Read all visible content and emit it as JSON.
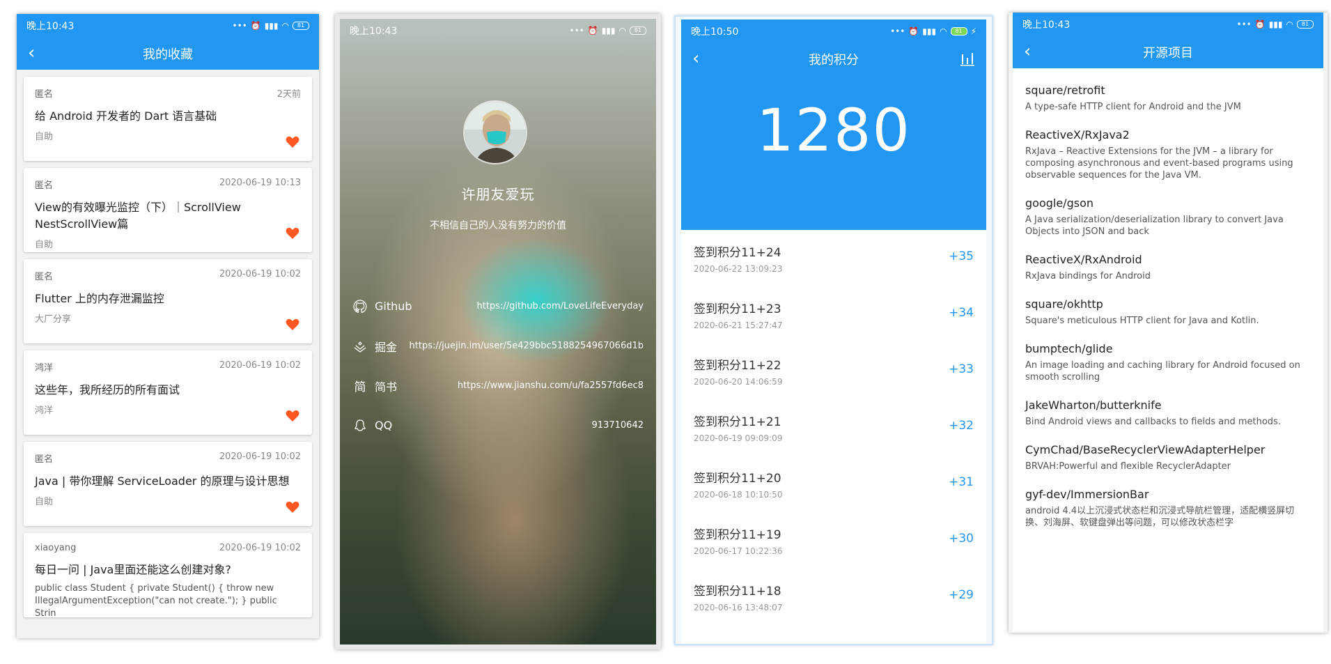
{
  "status": {
    "time1": "晚上10:43",
    "time2": "晚上10:43",
    "time3": "晚上10:50",
    "time4": "晚上10:43",
    "battery": "81"
  },
  "favorites": {
    "title": "我的收藏",
    "items": [
      {
        "author": "匿名",
        "date": "2天前",
        "title": "给 Android 开发者的 Dart 语言基础",
        "category": "自助"
      },
      {
        "author": "匿名",
        "date": "2020-06-19 10:13",
        "title": "View的有效曝光监控（下）｜ScrollView NestScrollView篇",
        "category": "自助"
      },
      {
        "author": "匿名",
        "date": "2020-06-19 10:02",
        "title": "Flutter 上的内存泄漏监控",
        "category": "大厂分享"
      },
      {
        "author": "鸿洋",
        "date": "2020-06-19 10:02",
        "title": "这些年，我所经历的所有面试",
        "category": "鸿洋"
      },
      {
        "author": "匿名",
        "date": "2020-06-19 10:02",
        "title": "Java | 带你理解 ServiceLoader 的原理与设计思想",
        "category": "自助"
      },
      {
        "author": "xiaoyang",
        "date": "2020-06-19 10:02",
        "title": "每日一问 | Java里面还能这么创建对象?",
        "excerpt": "public class Student { private Student() { throw new IllegalArgumentException(\"can not create.\"); } public Strin"
      }
    ]
  },
  "about": {
    "name": "许朋友爱玩",
    "motto": "不相信自己的人没有努力的价值",
    "links": [
      {
        "icon": "github-icon",
        "name": "Github",
        "value": "https://github.com/LoveLifeEveryday"
      },
      {
        "icon": "juejin-icon",
        "name": "掘金",
        "value": "https://juejin.im/user/5e429bbc5188254967066d1b"
      },
      {
        "icon": "jianshu-icon",
        "name": "简书",
        "value": "https://www.jianshu.com/u/fa2557fd6ec8"
      },
      {
        "icon": "qq-icon",
        "name": "QQ",
        "value": "913710642"
      }
    ],
    "jianshu_glyph": "简"
  },
  "points": {
    "title": "我的积分",
    "total": "1280",
    "records": [
      {
        "reason": "签到积分11+24",
        "time": "2020-06-22 13:09:23",
        "points": "+35"
      },
      {
        "reason": "签到积分11+23",
        "time": "2020-06-21 15:27:47",
        "points": "+34"
      },
      {
        "reason": "签到积分11+22",
        "time": "2020-06-20 14:06:59",
        "points": "+33"
      },
      {
        "reason": "签到积分11+21",
        "time": "2020-06-19 09:09:09",
        "points": "+32"
      },
      {
        "reason": "签到积分11+20",
        "time": "2020-06-18 10:10:50",
        "points": "+31"
      },
      {
        "reason": "签到积分11+19",
        "time": "2020-06-17 10:22:36",
        "points": "+30"
      },
      {
        "reason": "签到积分11+18",
        "time": "2020-06-16 13:48:07",
        "points": "+29"
      }
    ]
  },
  "opensource": {
    "title": "开源项目",
    "repos": [
      {
        "name": "square/retrofit",
        "desc": "A type-safe HTTP client for Android and the JVM"
      },
      {
        "name": "ReactiveX/RxJava2",
        "desc": "RxJava – Reactive Extensions for the JVM – a library for composing asynchronous and event-based programs using observable sequences for the Java VM."
      },
      {
        "name": "google/gson",
        "desc": "A Java serialization/deserialization library to convert Java Objects into JSON and back"
      },
      {
        "name": "ReactiveX/RxAndroid",
        "desc": "RxJava bindings for Android"
      },
      {
        "name": "square/okhttp",
        "desc": "Square's meticulous HTTP client for Java and Kotlin."
      },
      {
        "name": "bumptech/glide",
        "desc": "An image loading and caching library for Android focused on smooth scrolling"
      },
      {
        "name": "JakeWharton/butterknife",
        "desc": "Bind Android views and callbacks to fields and methods."
      },
      {
        "name": "CymChad/BaseRecyclerViewAdapterHelper",
        "desc": "BRVAH:Powerful and flexible RecyclerAdapter"
      },
      {
        "name": "gyf-dev/ImmersionBar",
        "desc": "android 4.4以上沉浸式状态栏和沉浸式导航栏管理，适配横竖屏切换、刘海屏、软键盘弹出等问题，可以修改状态栏字"
      }
    ]
  },
  "colors": {
    "primary": "#2196f3",
    "heart": "#ff5722"
  }
}
